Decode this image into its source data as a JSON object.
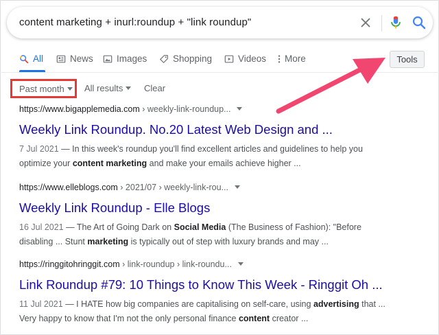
{
  "search": {
    "query": "content marketing + inurl:roundup + \"link roundup\""
  },
  "tabs": [
    {
      "label": "All",
      "icon": "search-icon",
      "active": true
    },
    {
      "label": "News",
      "icon": "news-icon"
    },
    {
      "label": "Images",
      "icon": "image-icon"
    },
    {
      "label": "Shopping",
      "icon": "tag-icon"
    },
    {
      "label": "Videos",
      "icon": "play-icon"
    },
    {
      "label": "More",
      "icon": "more-dots-icon"
    }
  ],
  "tools_label": "Tools",
  "filters": {
    "time": "Past month",
    "results": "All results",
    "clear": "Clear"
  },
  "results": [
    {
      "url_host": "https://www.bigapplemedia.com",
      "url_path": " › weekly-link-roundup...",
      "title": "Weekly Link Roundup. No.20 Latest Web Design and ...",
      "date": "7 Jul 2021",
      "line1_a": " — In this week's roundup you'll find excellent articles and guidelines to help you",
      "line2_a": "optimize your ",
      "line2_b": "content marketing",
      "line2_c": " and make your emails achieve higher ..."
    },
    {
      "url_host": "https://www.elleblogs.com",
      "url_path": " › 2021/07 › weekly-link-rou...",
      "title": "Weekly Link Roundup - Elle Blogs",
      "date": "16 Jul 2021",
      "line1_a": " — The Art of Going Dark on ",
      "line1_b": "Social Media",
      "line1_c": " (The Business of Fashion): \"Before",
      "line2_a": "disabling ... Stunt ",
      "line2_b": "marketing",
      "line2_c": " is typically out of step with luxury brands and may ..."
    },
    {
      "url_host": "https://ringgitohringgit.com",
      "url_path": " › link-roundup › link-roundu...",
      "title": "Link Roundup #79: 10 Things to Know This Week - Ringgit Oh ...",
      "date": "11 Jul 2021",
      "line1_a": " — I HATE how big companies are capitalising on self-care, using ",
      "line1_b": "advertising",
      "line1_c": " that ...",
      "line2_a": "Very happy to know that I'm not the only personal finance ",
      "line2_b": "content",
      "line2_c": " creator ..."
    }
  ],
  "colors": {
    "link": "#1a0dab",
    "accent": "#1a73e8",
    "highlight_box": "#e53935",
    "arrow": "#f0466f"
  }
}
